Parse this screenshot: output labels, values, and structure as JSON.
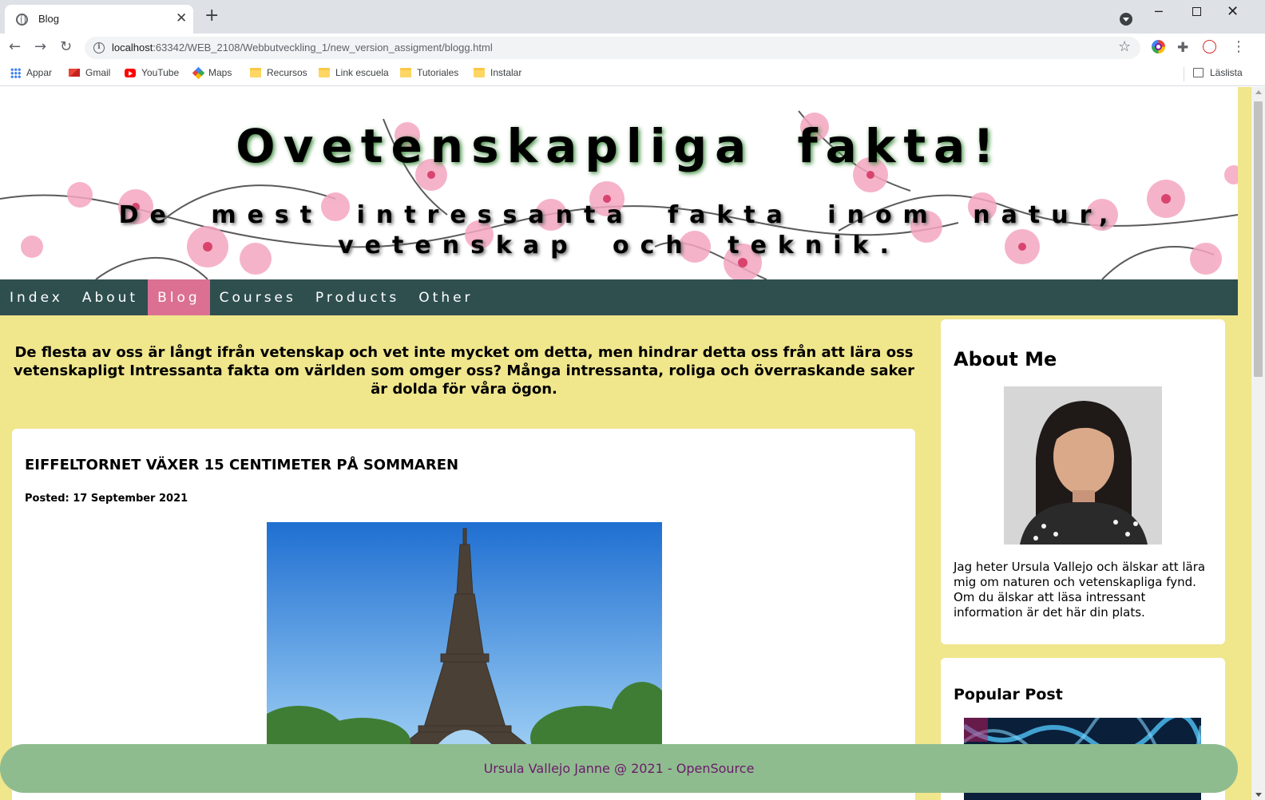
{
  "browser": {
    "tab_title": "Blog",
    "tab_close": "✕",
    "new_tab": "+",
    "url_host": "localhost",
    "url_rest": ":63342/WEB_2108/Webbutveckling_1/new_version_assigment/blogg.html",
    "bookmarks": [
      {
        "label": "Appar",
        "icon": "apps-icon"
      },
      {
        "label": "Gmail",
        "icon": "gmail-icon"
      },
      {
        "label": "YouTube",
        "icon": "youtube-icon"
      },
      {
        "label": "Maps",
        "icon": "maps-icon"
      },
      {
        "label": "Recursos",
        "icon": "folder-icon"
      },
      {
        "label": "Link escuela",
        "icon": "folder-icon"
      },
      {
        "label": "Tutoriales",
        "icon": "folder-icon"
      },
      {
        "label": "Instalar",
        "icon": "folder-icon"
      }
    ],
    "reading_list": "Läslista"
  },
  "header": {
    "title": "Ovetenskapliga fakta!",
    "subtitle": "De mest intressanta fakta inom natur, vetenskap och teknik."
  },
  "nav": {
    "items": [
      "Index",
      "About",
      "Blog",
      "Courses",
      "Products",
      "Other"
    ],
    "active": "Blog"
  },
  "main": {
    "intro": "De flesta av oss är långt ifrån vetenskap och vet inte mycket om detta, men hindrar detta oss från att lära oss vetenskapligt Intressanta fakta om världen som omger oss? Många intressanta, roliga och överraskande saker är dolda för våra ögon.",
    "post": {
      "title": "EIFFELTORNET VÄXER 15 CENTIMETER PÅ SOMMAREN",
      "date": "Posted: 17 September 2021"
    }
  },
  "sidebar": {
    "about_title": "About Me",
    "about_text": "Jag heter Ursula Vallejo och älskar att lära mig om naturen och vetenskapliga fynd. Om du älskar att läsa intressant information är det här din plats.",
    "popular_title": "Popular Post"
  },
  "footer": {
    "text": "Ursula Vallejo Janne @ 2021 - OpenSource"
  },
  "colors": {
    "page_bg": "#f0e68c",
    "nav_bg": "#2f4f4f",
    "nav_active": "#db7093",
    "footer_bg": "#8fbc8f",
    "footer_text": "#6a1b6a"
  }
}
